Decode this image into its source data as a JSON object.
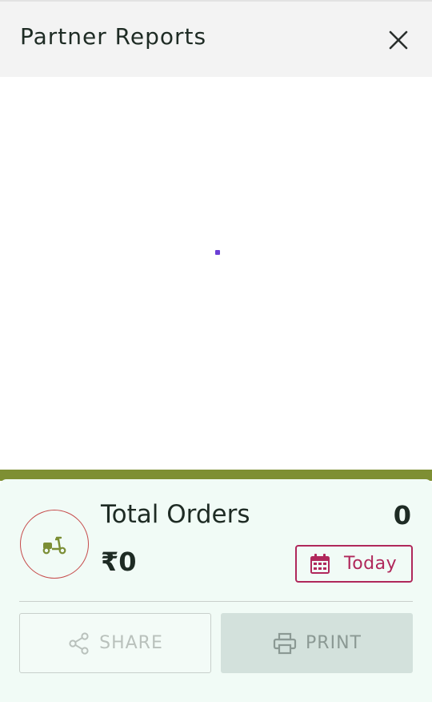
{
  "header": {
    "title": "Partner Reports",
    "close_icon": "close-icon"
  },
  "content": {
    "loading": true,
    "loader_color": "#6b3fd6"
  },
  "summary": {
    "avatar_icon": "scooter-icon",
    "orders_label": "Total Orders",
    "orders_count": "0",
    "amount": "₹0",
    "date_button": {
      "label": "Today",
      "icon": "calendar-icon"
    }
  },
  "actions": {
    "share": {
      "label": "SHARE",
      "icon": "share-icon"
    },
    "print": {
      "label": "PRINT",
      "icon": "printer-icon"
    }
  },
  "colors": {
    "accent_band": "#7e8f33",
    "date_accent": "#b0285b",
    "avatar_border": "#c64a4a",
    "panel_bg": "#f1fbf6"
  }
}
